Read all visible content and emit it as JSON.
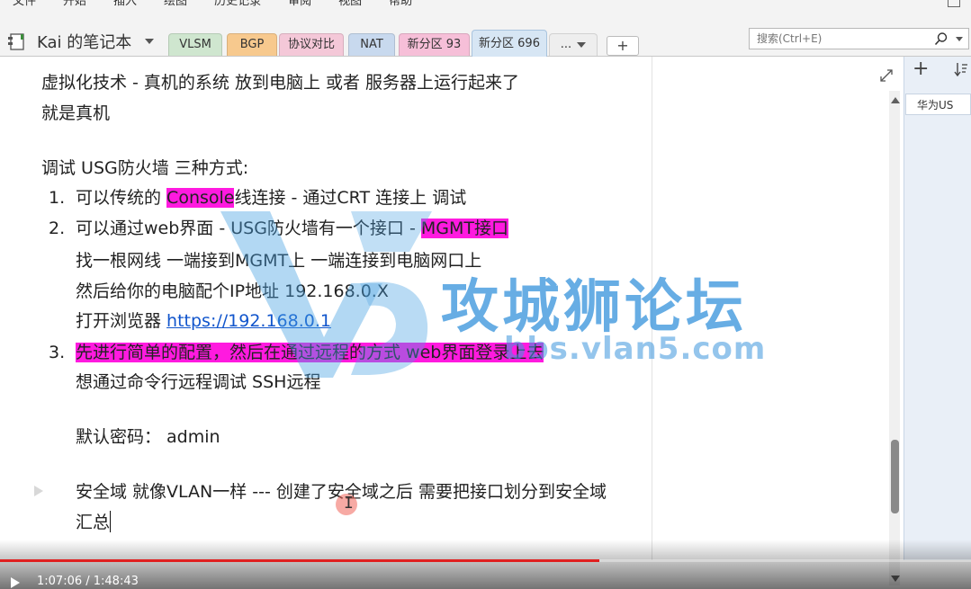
{
  "menu": {
    "items": [
      "文件",
      "开始",
      "插入",
      "绘图",
      "历史记录",
      "审阅",
      "视图",
      "帮助"
    ]
  },
  "notebook": {
    "title": "Kai 的笔记本"
  },
  "tabs": [
    {
      "label": "VLSM",
      "color": "#cfe6cf"
    },
    {
      "label": "BGP",
      "color": "#f7c98e"
    },
    {
      "label": "协议对比",
      "color": "#f4c8d8"
    },
    {
      "label": "NAT",
      "color": "#c8d9ee"
    },
    {
      "label": "新分区 93",
      "color": "#f6bfd8"
    },
    {
      "label": "新分区 696",
      "color": "#d7e6f4",
      "active": true
    },
    {
      "label": "...",
      "color": "#eeeeee"
    }
  ],
  "add_tab_label": "+",
  "search": {
    "placeholder": "搜索(Ctrl+E)"
  },
  "note": {
    "line1": "虚拟化技术 - 真机的系统 放到电脑上 或者 服务器上运行起来了",
    "line2": "就是真机",
    "line3": "调试 USG防火墙 三种方式:",
    "item1_num": "1.",
    "item1_pre": "可以传统的 ",
    "item1_hl": "Console",
    "item1_post": "线连接 - 通过CRT 连接上 调试",
    "item2_num": "2.",
    "item2_pre": "可以通过web界面 - USG防火墙有一个接口 - ",
    "item2_hl": "MGMT接口",
    "item2_sub1": "找一根网线 一端接到MGMT上   一端连接到电脑网口上",
    "item2_sub2": "然后给你的电脑配个IP地址  192.168.0.X",
    "item2_sub3_pre": "打开浏览器 ",
    "item2_sub3_link": "https://192.168.0.1",
    "item3_num": "3.",
    "item3_hl": "先进行简单的配置，然后在通过远程的方式 web界面登录上去",
    "item3_sub1": "想通过命令行远程调试 SSH远程",
    "password": "默认密码：  admin",
    "security_zone": "安全域 就像VLAN一样  --- 创建了安全域之后 需要把接口划分到安全域",
    "summary": "汇总"
  },
  "watermark": {
    "text": "攻城狮论坛",
    "url": "bbs.vlan5.com"
  },
  "page_list": {
    "items": [
      "华为US"
    ]
  },
  "video": {
    "time": "1:07:06 / 1:48:43",
    "progress": 0.617
  }
}
